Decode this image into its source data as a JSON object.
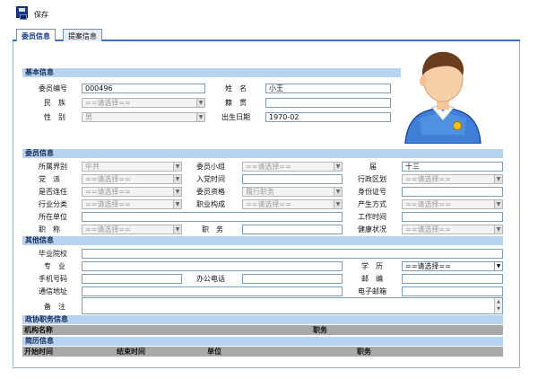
{
  "toolbar": {
    "save_label": "保存"
  },
  "tabs": [
    "委员信息",
    "提案信息"
  ],
  "basic": {
    "section": "基本信息",
    "member_no_label": "委员编号",
    "member_no": "000496",
    "name_label": "姓　名",
    "name": "小王",
    "ethnicity_label": "民　族",
    "ethnicity": "==请选择==",
    "native_label": "籍　贯",
    "native": "",
    "gender_label": "性　别",
    "gender": "男",
    "birth_label": "出生日期",
    "birth": "1970-02"
  },
  "member": {
    "section": "委员信息",
    "sector_label": "所属界别",
    "sector": "中共",
    "group_label": "委员小组",
    "group": "==请选择==",
    "term_label": "届",
    "term": "十三",
    "party_label": "党　派",
    "party": "==请选择==",
    "join_date_label": "入党时间",
    "join_date": "",
    "district_label": "行政区划",
    "district": "==请选择==",
    "reappoint_label": "是否连任",
    "reappoint": "==请选择==",
    "qualification_label": "委员资格",
    "qualification": "履行职务",
    "id_label": "身份证号",
    "id": "",
    "industry_label": "行业分类",
    "industry": "==请选择==",
    "structure_label": "职业构成",
    "structure": "==请选择==",
    "method_label": "产生方式",
    "method": "==请选择==",
    "workplace_label": "所在单位",
    "workplace": "",
    "work_date_label": "工作时间",
    "work_date": "",
    "title_label": "职　称",
    "title": "==请选择==",
    "position_label": "职　务",
    "position": "",
    "health_label": "健康状况",
    "health": "==请选择=="
  },
  "other": {
    "section": "其他信息",
    "school_label": "毕业院校",
    "school": "",
    "major_label": "专　业",
    "major": "",
    "education_label": "学　历",
    "education": "==请选择==",
    "mobile_label": "手机号码",
    "mobile": "",
    "office_phone_label": "办公电话",
    "office_phone": "",
    "postcode_label": "邮　编",
    "postcode": "",
    "address_label": "通信地址",
    "address": "",
    "email_label": "电子邮箱",
    "email": "",
    "remarks_label": "备　注",
    "remarks": ""
  },
  "cppcc": {
    "section": "政协职务信息",
    "col_org": "机构名称",
    "col_position": "职务"
  },
  "resume": {
    "section": "简历信息",
    "col_start": "开始时间",
    "col_end": "结束时间",
    "col_unit": "单位",
    "col_position": "职务"
  }
}
